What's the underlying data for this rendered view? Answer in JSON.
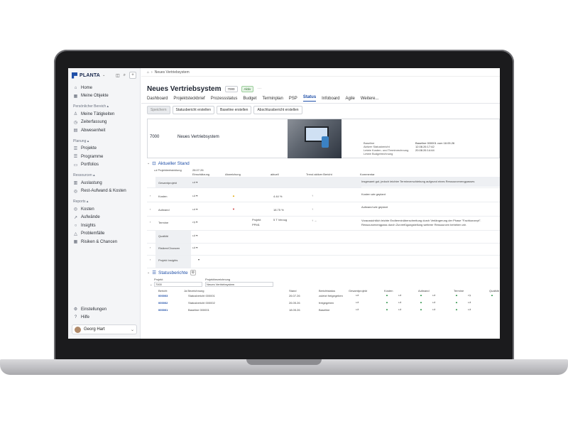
{
  "sidebar": {
    "brand": "PLANTA",
    "items_top": [
      {
        "label": "Home",
        "icon": "home-icon"
      },
      {
        "label": "Meine Objekte",
        "icon": "grid-icon"
      }
    ],
    "section1": "Persönlicher Bereich",
    "items1": [
      {
        "label": "Meine Tätigkeiten",
        "icon": "person-icon"
      },
      {
        "label": "Zeiterfassung",
        "icon": "clock-icon"
      },
      {
        "label": "Abwesenheit",
        "icon": "calendar-icon"
      }
    ],
    "section2": "Planung",
    "items2": [
      {
        "label": "Projekte",
        "icon": "list-icon"
      },
      {
        "label": "Programme",
        "icon": "list-icon"
      },
      {
        "label": "Portfolios",
        "icon": "folder-icon"
      }
    ],
    "section3": "Ressourcen",
    "items3": [
      {
        "label": "Auslastung",
        "icon": "bars-icon"
      },
      {
        "label": "Rest-Aufwand & Kosten",
        "icon": "coins-icon"
      }
    ],
    "section4": "Reports",
    "items4": [
      {
        "label": "Kosten",
        "icon": "coins-icon"
      },
      {
        "label": "Aufwände",
        "icon": "chart-icon"
      },
      {
        "label": "Insights",
        "icon": "bulb-icon"
      },
      {
        "label": "Problemfälle",
        "icon": "warning-icon"
      },
      {
        "label": "Risiken & Chancen",
        "icon": "grid-icon"
      }
    ],
    "bottom": [
      {
        "label": "Einstellungen",
        "icon": "gear-icon"
      },
      {
        "label": "Hilfe",
        "icon": "help-icon"
      }
    ],
    "user": "Georg Hart"
  },
  "breadcrumb": "Neues Vertriebsystem",
  "project": {
    "title": "Neues Vertriebsystem",
    "id": "7000",
    "status": "Aktiv",
    "more": "···"
  },
  "tabs": [
    "Dashboard",
    "Projektsteckbrief",
    "Prozessstatus",
    "Budget",
    "Terminplan",
    "PSP",
    "Status",
    "Infoboard",
    "Agile",
    "Weitere..."
  ],
  "active_tab": "Status",
  "toolbar": [
    "Speichern",
    "Statusbericht erstellen",
    "Baseline erstellen",
    "Abschlussbericht erstellen"
  ],
  "summary": {
    "id": "7000",
    "name": "Neues Vertriebsystem",
    "meta_labels": [
      "Baseline",
      "Aktiver Statusbericht",
      "Letzte Kosten- und Terminrechnung",
      "Letzte Budgetrechnung"
    ],
    "meta_values": [
      "Baseline 000001 vom 18.05.26",
      "",
      "12.08.26     17:42",
      "20.08.26     14:44"
    ]
  },
  "current": {
    "title": "Aktueller Stand",
    "date_label": "Projektentwicklung",
    "date": "28.07.26",
    "col_headers": [
      "Einschätzung",
      "Abweichung",
      "aktuell",
      "Trend aktiver Bericht",
      "Kommentar"
    ],
    "rows": [
      {
        "label": "Gesamtprojekt",
        "dev": "",
        "val": "",
        "trend": "",
        "comment": "Insgesamt gut, jedoch leichter Terminverschiebung aufgrund eines Ressourcenengpasses"
      },
      {
        "label": "Kosten",
        "dev": "▲",
        "val": "4.44 %",
        "trend": "↑",
        "comment": "Kosten wie geplant"
      },
      {
        "label": "Aufwand",
        "dev": "▼",
        "val": "18.75 %",
        "trend": "↑",
        "comment": "Aufwand wie geplant"
      },
      {
        "label": "Termine",
        "dev": "",
        "val": "5 T Verzug",
        "trend": "↑ →",
        "comment": "Voraussichtlich leichte Endterminüberschreitung durch Verlängerung der Phase \"Fachkonzept\". Ressourcenengpass durch Zurverfügungstellung weiterer Ressourcen beheben wir."
      },
      {
        "label": "Qualität",
        "dev": "",
        "val": "",
        "trend": "",
        "comment": ""
      },
      {
        "label": "Risiken/Chancen",
        "dev": "",
        "val": "",
        "trend": "",
        "comment": ""
      },
      {
        "label": "Projekt Insights",
        "dev": "",
        "val": "",
        "trend": "",
        "comment": ""
      }
    ],
    "termine_sub": [
      "Projekt",
      "PPM1"
    ]
  },
  "reports": {
    "title": "Statusberichte",
    "proj_label": "Projekt",
    "proj_desc_label": "Projektbezeichnung",
    "proj_id": "7000",
    "proj_name": "Neues Vertriebsystem",
    "headers": [
      "Bericht",
      "Ja Bezeichnung",
      "Stand",
      "Berichtstatus",
      "Gesamtprojekt",
      "Kosten",
      "Aufwand",
      "Termine",
      "Qualität"
    ],
    "rows": [
      {
        "id": "000003",
        "name": "Statusbericht 000001",
        "date": "26.07.26",
        "status": "zuletzt freigegeben"
      },
      {
        "id": "000002",
        "name": "Statusbericht 000002",
        "date": "26.05.26",
        "status": "freigegeben"
      },
      {
        "id": "000001",
        "name": "Baseline 000001",
        "date": "18.05.26",
        "status": "Baseline"
      }
    ]
  }
}
